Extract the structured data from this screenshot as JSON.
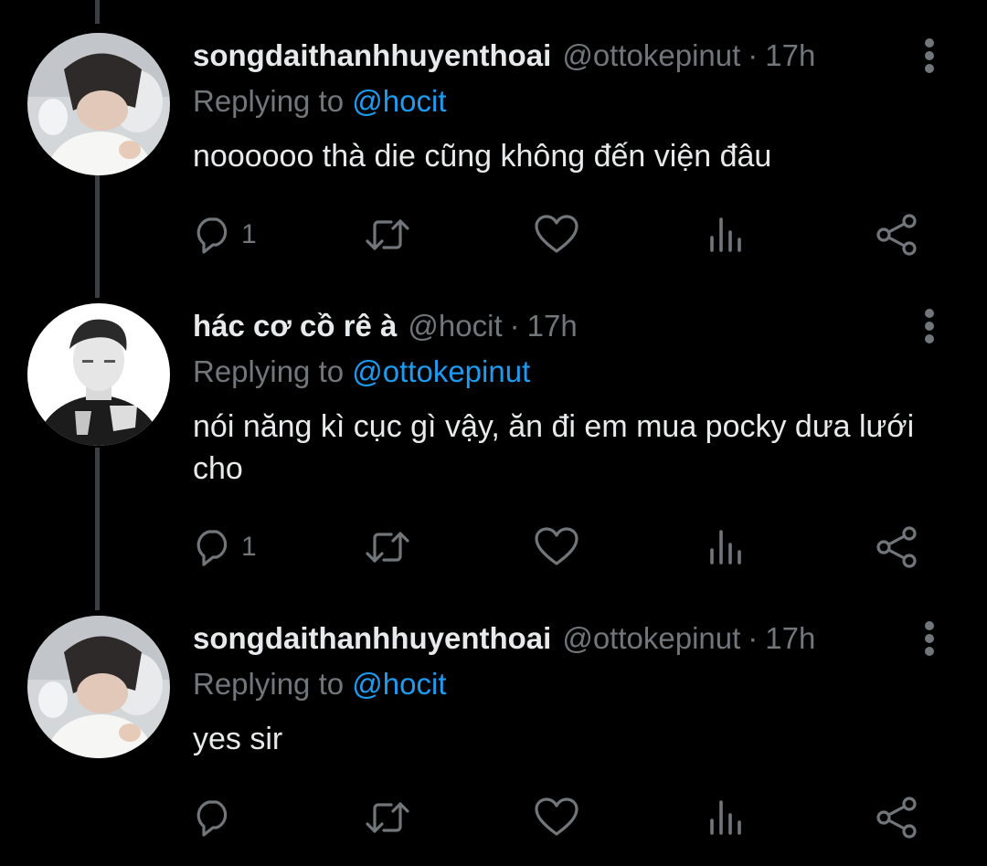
{
  "colors": {
    "background": "#000000",
    "text_primary": "#e7e9ea",
    "text_secondary": "#71767b",
    "accent": "#1d9bf0",
    "thread_line": "#3b3f44"
  },
  "tweets": [
    {
      "display_name": "songdaithanhhuyenthoai",
      "handle": "@ottokepinut",
      "separator": "·",
      "time": "17h",
      "replying_prefix": "Replying to",
      "replying_to": "@hocit",
      "text": "noooooo thà die cũng không đến viện đâu",
      "reply_count": "1",
      "icons": [
        "more-vertical-icon",
        "reply-icon",
        "retweet-icon",
        "like-icon",
        "analytics-icon",
        "share-icon"
      ]
    },
    {
      "display_name": "hác cơ cồ rê à",
      "handle": "@hocit",
      "separator": "·",
      "time": "17h",
      "replying_prefix": "Replying to",
      "replying_to": "@ottokepinut",
      "text": "nói năng kì cục gì vậy, ăn đi em mua pocky dưa lưới cho",
      "reply_count": "1",
      "icons": [
        "more-vertical-icon",
        "reply-icon",
        "retweet-icon",
        "like-icon",
        "analytics-icon",
        "share-icon"
      ]
    },
    {
      "display_name": "songdaithanhhuyenthoai",
      "handle": "@ottokepinut",
      "separator": "·",
      "time": "17h",
      "replying_prefix": "Replying to",
      "replying_to": "@hocit",
      "text": "yes sir",
      "reply_count": "",
      "icons": [
        "more-vertical-icon",
        "reply-icon",
        "retweet-icon",
        "like-icon",
        "analytics-icon",
        "share-icon"
      ]
    }
  ]
}
